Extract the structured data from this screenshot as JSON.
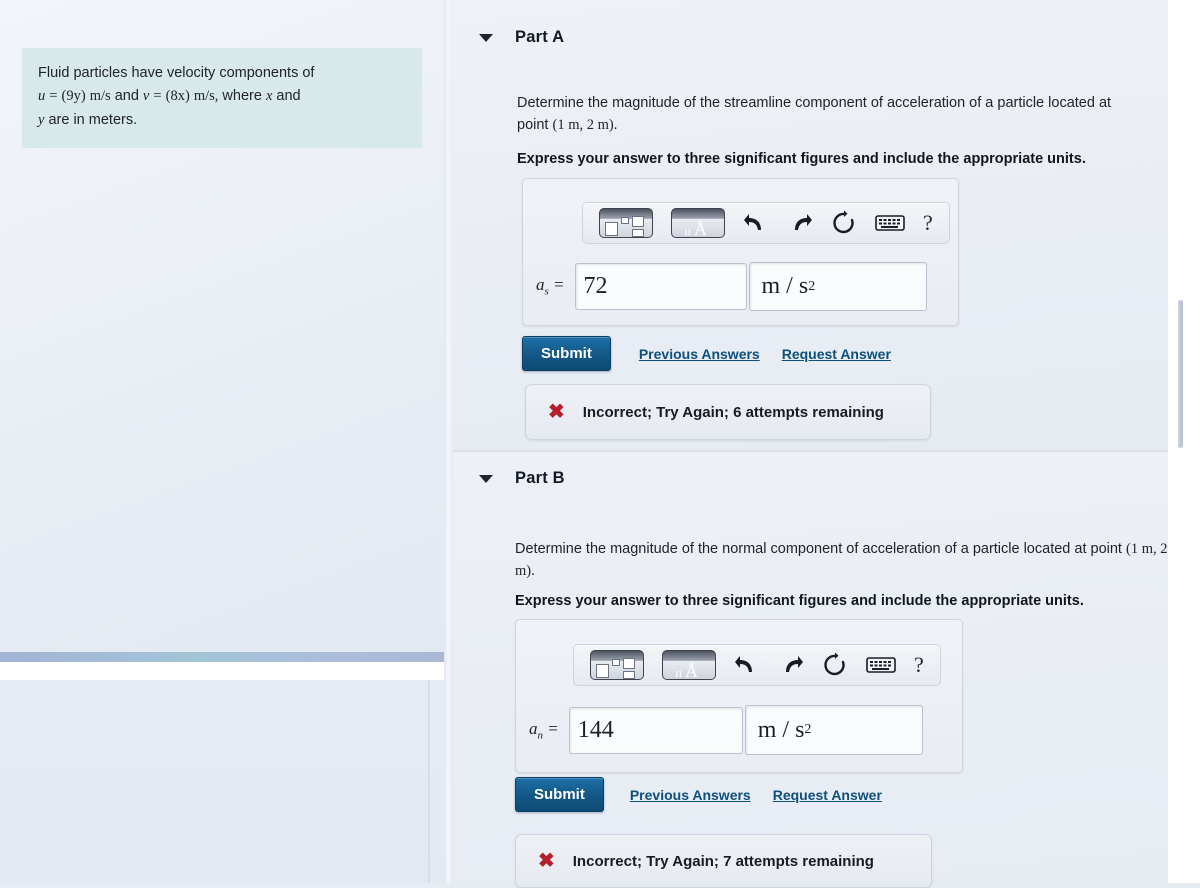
{
  "left_panel": {
    "problem_statement": {
      "line1": "Fluid particles have velocity components of",
      "u_var": "u",
      "eq1": "=",
      "u_expr": "(9y)",
      "u_units": "m/s",
      "and1": "and",
      "v_var": "v",
      "eq2": "=",
      "v_expr": "(8x)",
      "v_units": "m/s,",
      "where": "where",
      "x_var": "x",
      "and2": "and",
      "y_var": "y",
      "line3_tail": "are in meters.",
      "background_color": "#d7e9ea"
    }
  },
  "parts": [
    {
      "id": "part-a",
      "caret_icon": "triangle-down-icon",
      "title": "Part A",
      "question": "Determine the magnitude of the streamline component of acceleration of a particle located at point (1 m, 2 m).",
      "question_plain_1": "Determine the magnitude of the streamline component of acceleration of a particle",
      "question_plain_2": "located at point",
      "question_point": "(1 m, 2 m).",
      "instruction": "Express your answer to three significant figures and include the appropriate units.",
      "toolbar": {
        "template_button": "math-template-icon",
        "units_button": "units-angstrom-icon",
        "undo": "undo-arrow-icon",
        "redo": "redo-arrow-icon",
        "reset": "reset-circle-icon",
        "keyboard": "keyboard-icon",
        "help": "?"
      },
      "answer": {
        "label_symbol": "a",
        "label_subscript": "s",
        "label_equals": "=",
        "value": "72",
        "units_main": "m / s",
        "units_exponent": "2"
      },
      "submit_label": "Submit",
      "previous_answers_label": "Previous Answers",
      "request_answer_label": "Request Answer",
      "feedback": {
        "icon": "x-mark-icon",
        "text": "Incorrect; Try Again; 6 attempts remaining",
        "icon_color": "#b41f2b"
      }
    },
    {
      "id": "part-b",
      "caret_icon": "triangle-down-icon",
      "title": "Part B",
      "question": "Determine the magnitude of the normal component of acceleration of a particle located at point (1 m, 2 m).",
      "question_plain_1": "Determine the magnitude of the normal component of acceleration of a particle located at",
      "question_plain_2": "point",
      "question_point": "(1 m, 2 m).",
      "instruction": "Express your answer to three significant figures and include the appropriate units.",
      "toolbar": {
        "template_button": "math-template-icon",
        "units_button": "units-angstrom-icon",
        "undo": "undo-arrow-icon",
        "redo": "redo-arrow-icon",
        "reset": "reset-circle-icon",
        "keyboard": "keyboard-icon",
        "help": "?"
      },
      "answer": {
        "label_symbol": "a",
        "label_subscript": "n",
        "label_equals": "=",
        "value": "144",
        "units_main": "m / s",
        "units_exponent": "2"
      },
      "submit_label": "Submit",
      "previous_answers_label": "Previous Answers",
      "request_answer_label": "Request Answer",
      "feedback": {
        "icon": "x-mark-icon",
        "text": "Incorrect; Try Again; 7 attempts remaining",
        "icon_color": "#b41f2b"
      }
    }
  ],
  "colors": {
    "submit_blue": "#135785",
    "link_blue": "#0d4f7d",
    "error_red": "#b41f2b",
    "problem_teal": "#d7e9ea"
  }
}
